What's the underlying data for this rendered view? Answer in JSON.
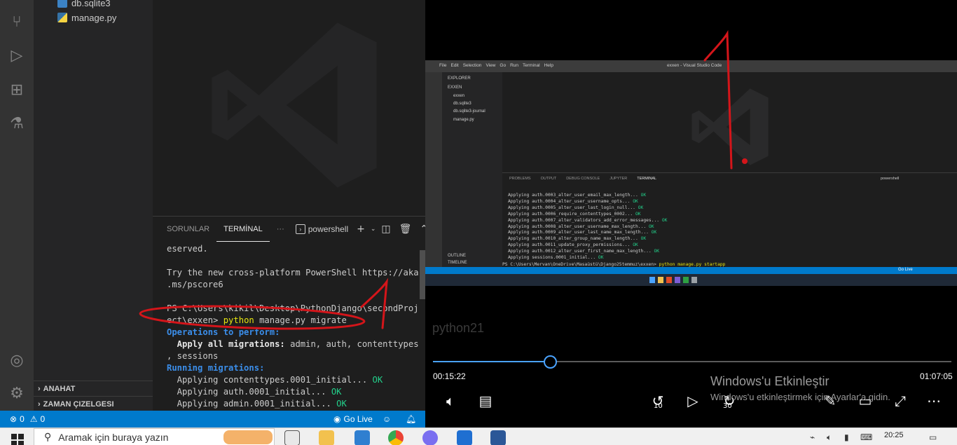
{
  "vscode": {
    "files": [
      {
        "name": "db.sqlite3",
        "icon": "database-icon"
      },
      {
        "name": "manage.py",
        "icon": "python-file-icon"
      }
    ],
    "sections": [
      "ANAHAT",
      "ZAMAN ÇIZELGESI"
    ],
    "panel_tabs": {
      "problems": "SORUNLAR",
      "terminal": "TERMİNAL",
      "more": "···",
      "shell": "powershell"
    },
    "terminal": {
      "l1": "eserved.",
      "l2": "Try the new cross-platform PowerShell https://aka",
      "l3": ".ms/pscore6",
      "l4": "PS C:\\Users\\kikil\\Desktop\\PythonDjango\\secondProj",
      "l5_prefix": "ect\\exxen> ",
      "l5_cmd": "python",
      "l5_rest": " manage.py migrate",
      "l6": "Operations to perform:",
      "l7_bold": "  Apply all migrations:",
      "l7_rest": " admin, auth, contenttypes",
      "l8": ", sessions",
      "l9": "Running migrations:",
      "l10": "  Applying contenttypes.0001_initial... ",
      "l11": "  Applying auth.0001_initial... ",
      "l12": "  Applying admin.0001_initial... ",
      "ok": "OK"
    },
    "status": {
      "errors": "0",
      "warnings": "0",
      "golive": "Go Live"
    }
  },
  "player": {
    "frame": {
      "menu": [
        "File",
        "Edit",
        "Selection",
        "View",
        "Go",
        "Run",
        "Terminal",
        "Help"
      ],
      "title": "exxen - Visual Studio Code",
      "explorer": [
        "EXPLORER",
        "EXXEN",
        "exxen",
        "db.sqlite3",
        "db.sqlite3-journal",
        "manage.py",
        "OUTLINE",
        "TIMELINE"
      ],
      "panel_tabs": [
        "PROBLEMS",
        "OUTPUT",
        "DEBUG CONSOLE",
        "JUPYTER",
        "TERMINAL"
      ],
      "shell": "powershell",
      "lines": [
        "Applying auth.0003_alter_user_email_max_length... ",
        "Applying auth.0004_alter_user_username_opts... ",
        "Applying auth.0005_alter_user_last_login_null... ",
        "Applying auth.0006_require_contenttypes_0002... ",
        "Applying auth.0007_alter_validators_add_error_messages... ",
        "Applying auth.0008_alter_user_username_max_length... ",
        "Applying auth.0009_alter_user_last_name_max_length... ",
        "Applying auth.0010_alter_group_name_max_length... ",
        "Applying auth.0011_update_proxy_permissions... ",
        "Applying auth.0012_alter_user_first_name_max_length... ",
        "Applying sessions.0001_initial... "
      ],
      "ok": "OK",
      "prompt": "PS C:\\Users\\Mervan\\OneDrive\\Masaüstü\\Django25temmuz\\exxen> ",
      "prompt_cmd": "python manage.py startapp",
      "golive": "Go Live"
    },
    "video_title": "python21",
    "progress": 0.2271,
    "current_time": "00:15:22",
    "total_time": "01:07:05",
    "skip_back": "10",
    "skip_forward": "30",
    "activation_title": "Windows'u Etkinleştir",
    "activation_text": "Windows'u etkinleştirmek için Ayarlar'a gidin."
  },
  "taskbar": {
    "search_placeholder": "Aramak için buraya yazın",
    "time": "20:25"
  },
  "colors": {
    "vscode_blue": "#007acc",
    "seek": "#4aa3ff",
    "annotation": "#d4151a"
  }
}
